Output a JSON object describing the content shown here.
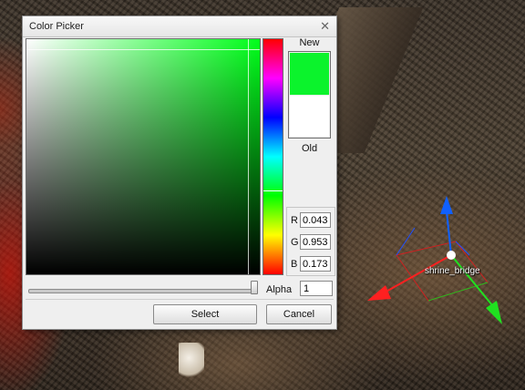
{
  "dialog": {
    "title": "Color Picker",
    "close_icon": "close-icon"
  },
  "picker": {
    "saturation": 0.95,
    "value": 0.95,
    "hue_degrees": 128
  },
  "preview": {
    "new_label": "New",
    "old_label": "Old",
    "new_color": "#0bf32c",
    "old_color": "#ffffff"
  },
  "rgb": {
    "r_label": "R",
    "g_label": "G",
    "b_label": "B",
    "r_value": "0.043",
    "g_value": "0.953",
    "b_value": "0.173"
  },
  "alpha": {
    "label": "Alpha",
    "value": "1",
    "fraction": 1.0
  },
  "buttons": {
    "select": "Select",
    "cancel": "Cancel"
  },
  "scene": {
    "object_label": "shrine_bridge",
    "gizmo_icon": "transform-gizmo-icon"
  },
  "colors": {
    "axis_x": "#ff2020",
    "axis_y": "#1060ff",
    "axis_z": "#20e020"
  }
}
